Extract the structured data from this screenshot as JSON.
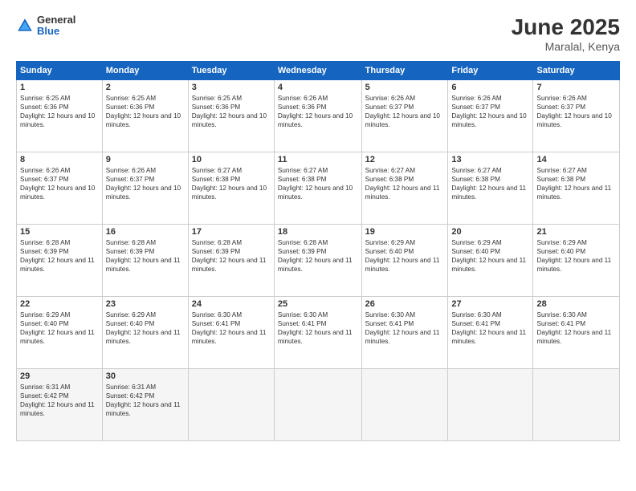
{
  "header": {
    "logo_general": "General",
    "logo_blue": "Blue",
    "month_title": "June 2025",
    "subtitle": "Maralal, Kenya"
  },
  "days_of_week": [
    "Sunday",
    "Monday",
    "Tuesday",
    "Wednesday",
    "Thursday",
    "Friday",
    "Saturday"
  ],
  "weeks": [
    [
      {
        "day": "1",
        "sunrise": "6:25 AM",
        "sunset": "6:36 PM",
        "daylight": "12 hours and 10 minutes."
      },
      {
        "day": "2",
        "sunrise": "6:25 AM",
        "sunset": "6:36 PM",
        "daylight": "12 hours and 10 minutes."
      },
      {
        "day": "3",
        "sunrise": "6:25 AM",
        "sunset": "6:36 PM",
        "daylight": "12 hours and 10 minutes."
      },
      {
        "day": "4",
        "sunrise": "6:26 AM",
        "sunset": "6:36 PM",
        "daylight": "12 hours and 10 minutes."
      },
      {
        "day": "5",
        "sunrise": "6:26 AM",
        "sunset": "6:37 PM",
        "daylight": "12 hours and 10 minutes."
      },
      {
        "day": "6",
        "sunrise": "6:26 AM",
        "sunset": "6:37 PM",
        "daylight": "12 hours and 10 minutes."
      },
      {
        "day": "7",
        "sunrise": "6:26 AM",
        "sunset": "6:37 PM",
        "daylight": "12 hours and 10 minutes."
      }
    ],
    [
      {
        "day": "8",
        "sunrise": "6:26 AM",
        "sunset": "6:37 PM",
        "daylight": "12 hours and 10 minutes."
      },
      {
        "day": "9",
        "sunrise": "6:26 AM",
        "sunset": "6:37 PM",
        "daylight": "12 hours and 10 minutes."
      },
      {
        "day": "10",
        "sunrise": "6:27 AM",
        "sunset": "6:38 PM",
        "daylight": "12 hours and 10 minutes."
      },
      {
        "day": "11",
        "sunrise": "6:27 AM",
        "sunset": "6:38 PM",
        "daylight": "12 hours and 10 minutes."
      },
      {
        "day": "12",
        "sunrise": "6:27 AM",
        "sunset": "6:38 PM",
        "daylight": "12 hours and 11 minutes."
      },
      {
        "day": "13",
        "sunrise": "6:27 AM",
        "sunset": "6:38 PM",
        "daylight": "12 hours and 11 minutes."
      },
      {
        "day": "14",
        "sunrise": "6:27 AM",
        "sunset": "6:38 PM",
        "daylight": "12 hours and 11 minutes."
      }
    ],
    [
      {
        "day": "15",
        "sunrise": "6:28 AM",
        "sunset": "6:39 PM",
        "daylight": "12 hours and 11 minutes."
      },
      {
        "day": "16",
        "sunrise": "6:28 AM",
        "sunset": "6:39 PM",
        "daylight": "12 hours and 11 minutes."
      },
      {
        "day": "17",
        "sunrise": "6:28 AM",
        "sunset": "6:39 PM",
        "daylight": "12 hours and 11 minutes."
      },
      {
        "day": "18",
        "sunrise": "6:28 AM",
        "sunset": "6:39 PM",
        "daylight": "12 hours and 11 minutes."
      },
      {
        "day": "19",
        "sunrise": "6:29 AM",
        "sunset": "6:40 PM",
        "daylight": "12 hours and 11 minutes."
      },
      {
        "day": "20",
        "sunrise": "6:29 AM",
        "sunset": "6:40 PM",
        "daylight": "12 hours and 11 minutes."
      },
      {
        "day": "21",
        "sunrise": "6:29 AM",
        "sunset": "6:40 PM",
        "daylight": "12 hours and 11 minutes."
      }
    ],
    [
      {
        "day": "22",
        "sunrise": "6:29 AM",
        "sunset": "6:40 PM",
        "daylight": "12 hours and 11 minutes."
      },
      {
        "day": "23",
        "sunrise": "6:29 AM",
        "sunset": "6:40 PM",
        "daylight": "12 hours and 11 minutes."
      },
      {
        "day": "24",
        "sunrise": "6:30 AM",
        "sunset": "6:41 PM",
        "daylight": "12 hours and 11 minutes."
      },
      {
        "day": "25",
        "sunrise": "6:30 AM",
        "sunset": "6:41 PM",
        "daylight": "12 hours and 11 minutes."
      },
      {
        "day": "26",
        "sunrise": "6:30 AM",
        "sunset": "6:41 PM",
        "daylight": "12 hours and 11 minutes."
      },
      {
        "day": "27",
        "sunrise": "6:30 AM",
        "sunset": "6:41 PM",
        "daylight": "12 hours and 11 minutes."
      },
      {
        "day": "28",
        "sunrise": "6:30 AM",
        "sunset": "6:41 PM",
        "daylight": "12 hours and 11 minutes."
      }
    ],
    [
      {
        "day": "29",
        "sunrise": "6:31 AM",
        "sunset": "6:42 PM",
        "daylight": "12 hours and 11 minutes."
      },
      {
        "day": "30",
        "sunrise": "6:31 AM",
        "sunset": "6:42 PM",
        "daylight": "12 hours and 11 minutes."
      },
      null,
      null,
      null,
      null,
      null
    ]
  ]
}
